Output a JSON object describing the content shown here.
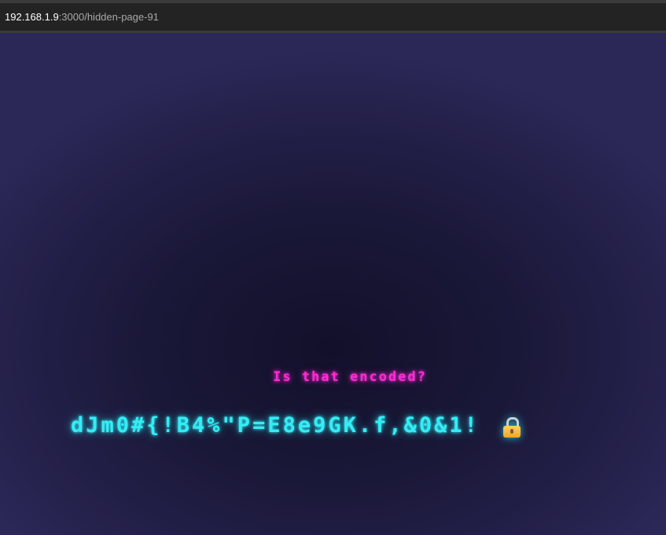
{
  "browser": {
    "url_host": "192.168.1.9",
    "url_rest": ":3000/hidden-page-91"
  },
  "page": {
    "question": "Is that encoded?",
    "encoded_text": "dJm0#{!B4%\"P=E8e9GK.f,&0&1!",
    "lock_icon": "lock-icon"
  },
  "colors": {
    "question": "#ff2bd6",
    "encoded": "#35ecf5",
    "background": "#1a1838"
  }
}
